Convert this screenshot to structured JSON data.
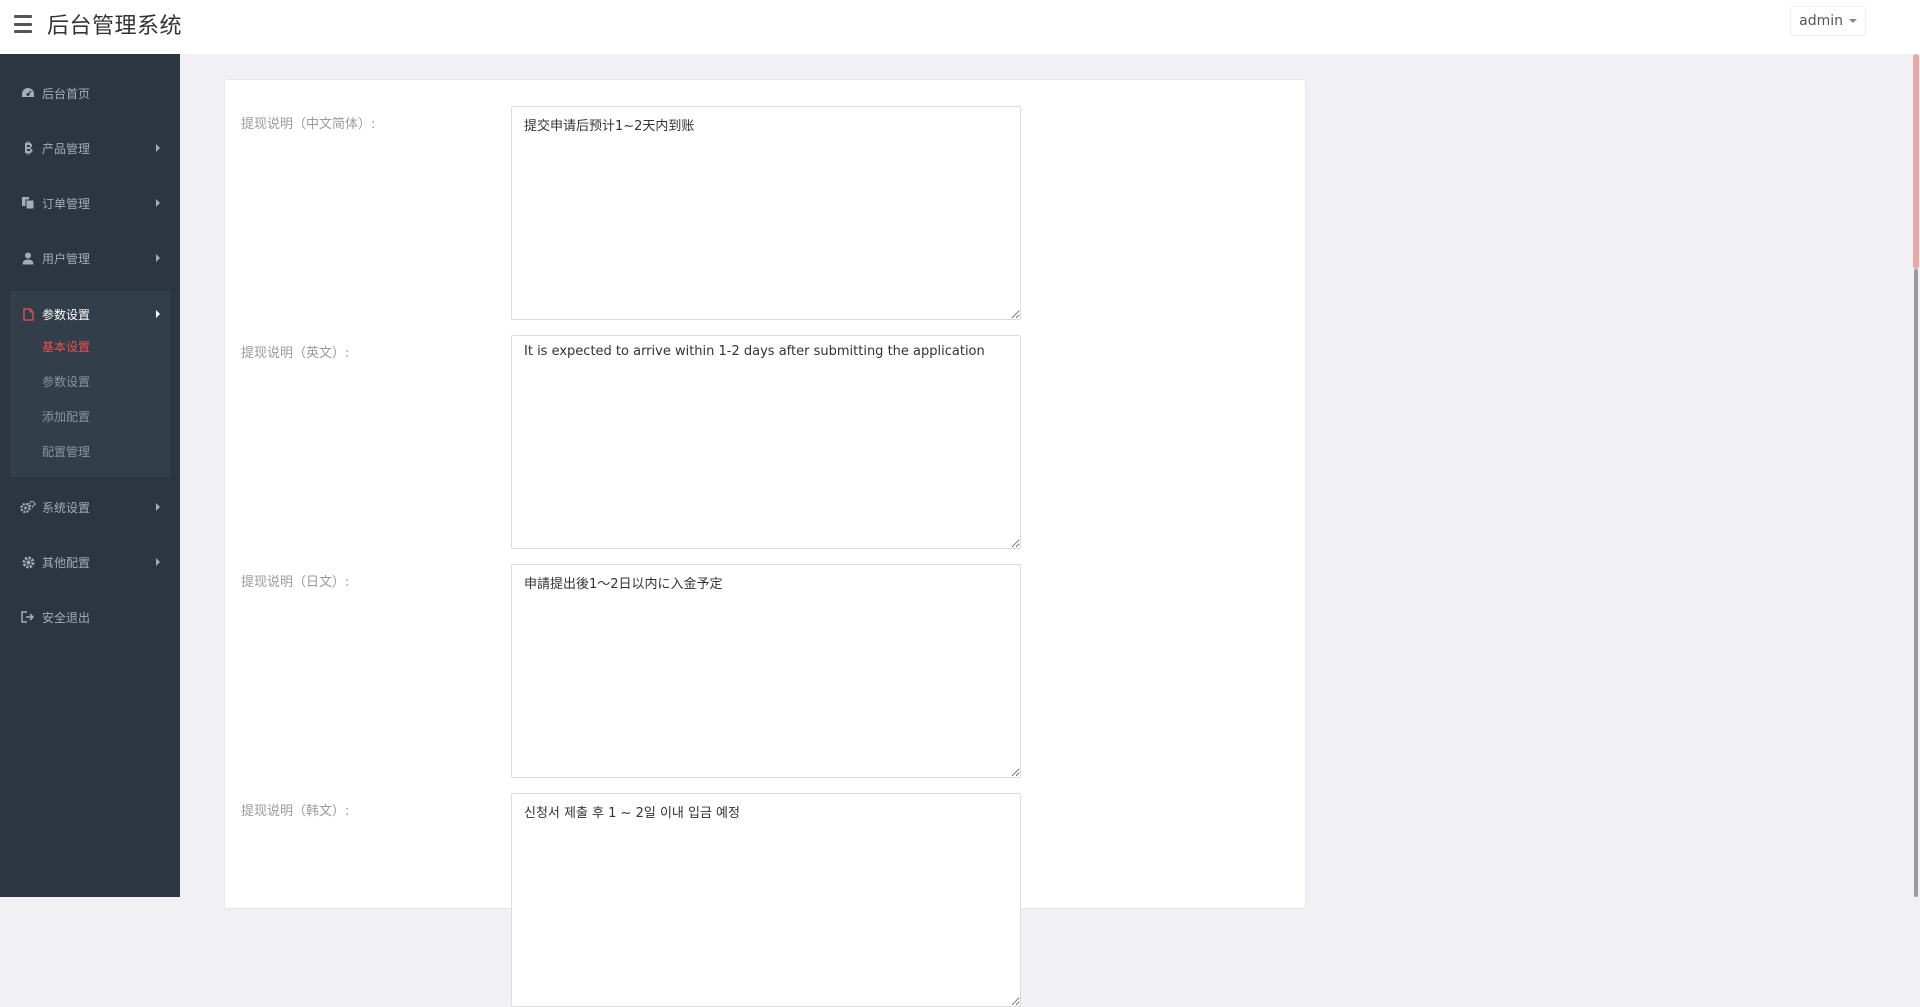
{
  "header": {
    "title": "后台管理系统",
    "user": "admin"
  },
  "sidebar": {
    "items": [
      {
        "label": "后台首页",
        "icon": "dashboard-icon",
        "has_arrow": false
      },
      {
        "label": "产品管理",
        "icon": "bitcoin-icon",
        "has_arrow": true
      },
      {
        "label": "订单管理",
        "icon": "copy-icon",
        "has_arrow": true
      },
      {
        "label": "用户管理",
        "icon": "user-icon",
        "has_arrow": true
      },
      {
        "label": "参数设置",
        "icon": "file-icon",
        "has_arrow": true,
        "active": true
      },
      {
        "label": "系统设置",
        "icon": "gears-icon",
        "has_arrow": true
      },
      {
        "label": "其他配置",
        "icon": "gear-icon",
        "has_arrow": true
      },
      {
        "label": "安全退出",
        "icon": "sign-out-icon",
        "has_arrow": false
      }
    ],
    "subitems": [
      {
        "label": "基本设置",
        "current": true
      },
      {
        "label": "参数设置",
        "current": false
      },
      {
        "label": "添加配置",
        "current": false
      },
      {
        "label": "配置管理",
        "current": false
      }
    ],
    "accent_color": "#f04f4f"
  },
  "form": {
    "fields": [
      {
        "label": "提现说明（中文简体）:",
        "value": "提交申请后预计1~2天内到账"
      },
      {
        "label": "提现说明（英文）:",
        "value": "It is expected to arrive within 1-2 days after submitting the application"
      },
      {
        "label": "提现说明（日文）:",
        "value": "申請提出後1～2日以内に入金予定"
      },
      {
        "label": "提现说明（韩文）:",
        "value": "신청서 제출 후 1 ~ 2일 이내 입금 예정"
      }
    ]
  }
}
